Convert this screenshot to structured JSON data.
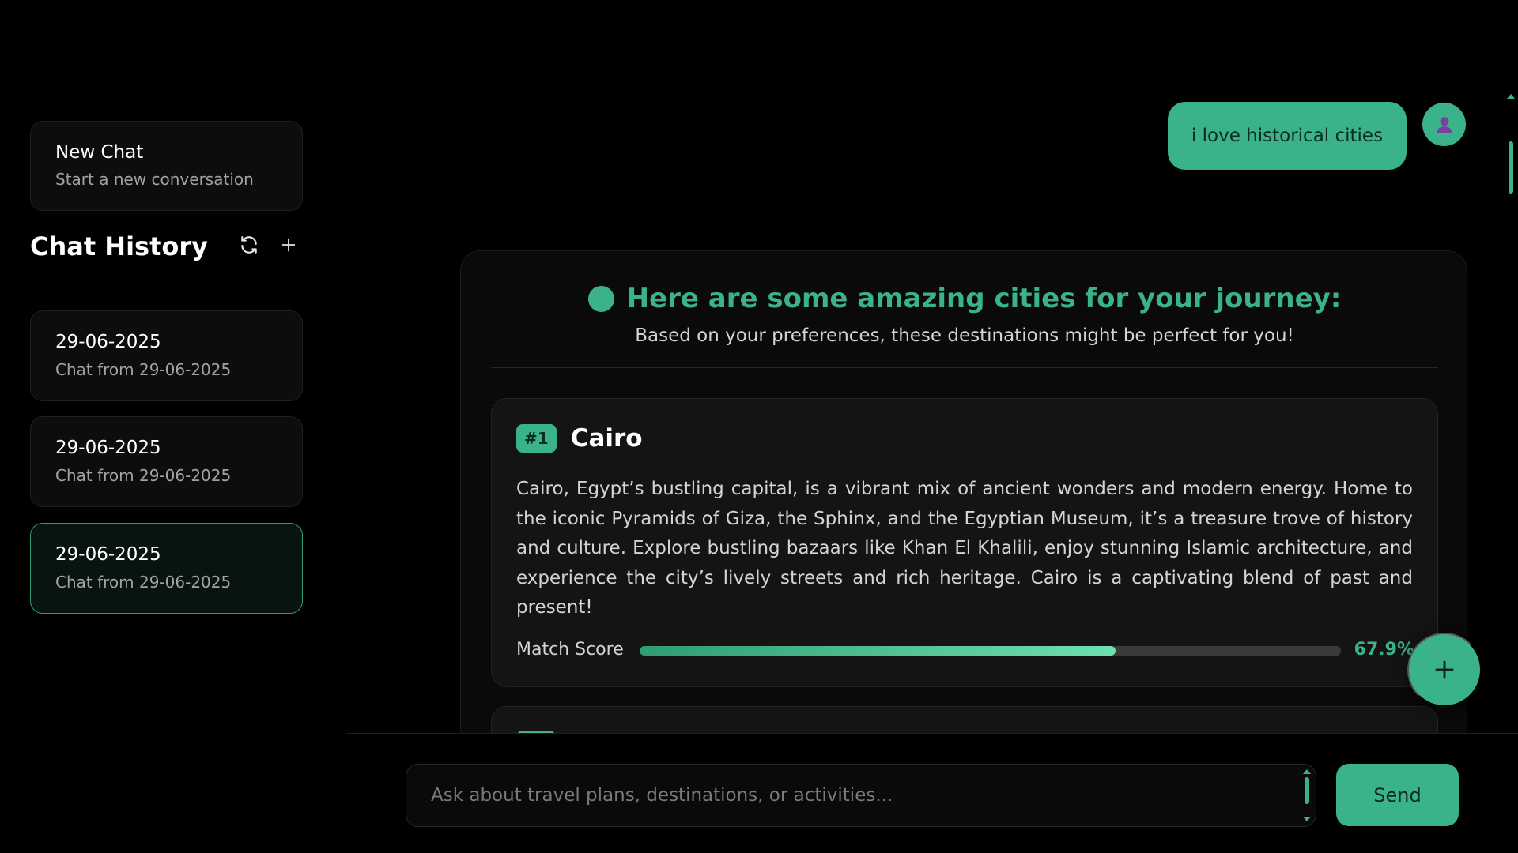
{
  "sidebar": {
    "new_chat": {
      "title": "New Chat",
      "subtitle": "Start a new conversation"
    },
    "history": {
      "title": "Chat History",
      "refresh_icon": "refresh-icon",
      "add_icon": "plus-icon",
      "items": [
        {
          "date": "29-06-2025",
          "subtitle": "Chat from 29-06-2025",
          "active": false
        },
        {
          "date": "29-06-2025",
          "subtitle": "Chat from 29-06-2025",
          "active": false
        },
        {
          "date": "29-06-2025",
          "subtitle": "Chat from 29-06-2025",
          "active": true
        }
      ]
    }
  },
  "conversation": {
    "user_message": "i love historical cities",
    "user_avatar_icon": "user-icon",
    "response": {
      "title": "Here are some amazing cities for your journey:",
      "subtitle": "Based on your preferences, these destinations might be perfect for you!",
      "cities": [
        {
          "rank": "#1",
          "name": "Cairo",
          "description": "Cairo, Egypt’s bustling capital, is a vibrant mix of ancient wonders and modern energy. Home to the iconic Pyramids of Giza, the Sphinx, and the Egyptian Museum, it’s a treasure trove of history and culture. Explore bustling bazaars like Khan El Khalili, enjoy stunning Islamic architecture, and experience the city’s lively streets and rich heritage. Cairo is a captivating blend of past and present!",
          "match_label": "Match Score",
          "match_value": "67.9%",
          "match_fraction": 0.679
        }
      ]
    }
  },
  "input": {
    "placeholder": "Ask about travel plans, destinations, or activities...",
    "value": "",
    "send_label": "Send"
  },
  "fab_icon": "plus-icon",
  "colors": {
    "accent": "#3bb38a",
    "background": "#000000",
    "card": "#141414"
  }
}
